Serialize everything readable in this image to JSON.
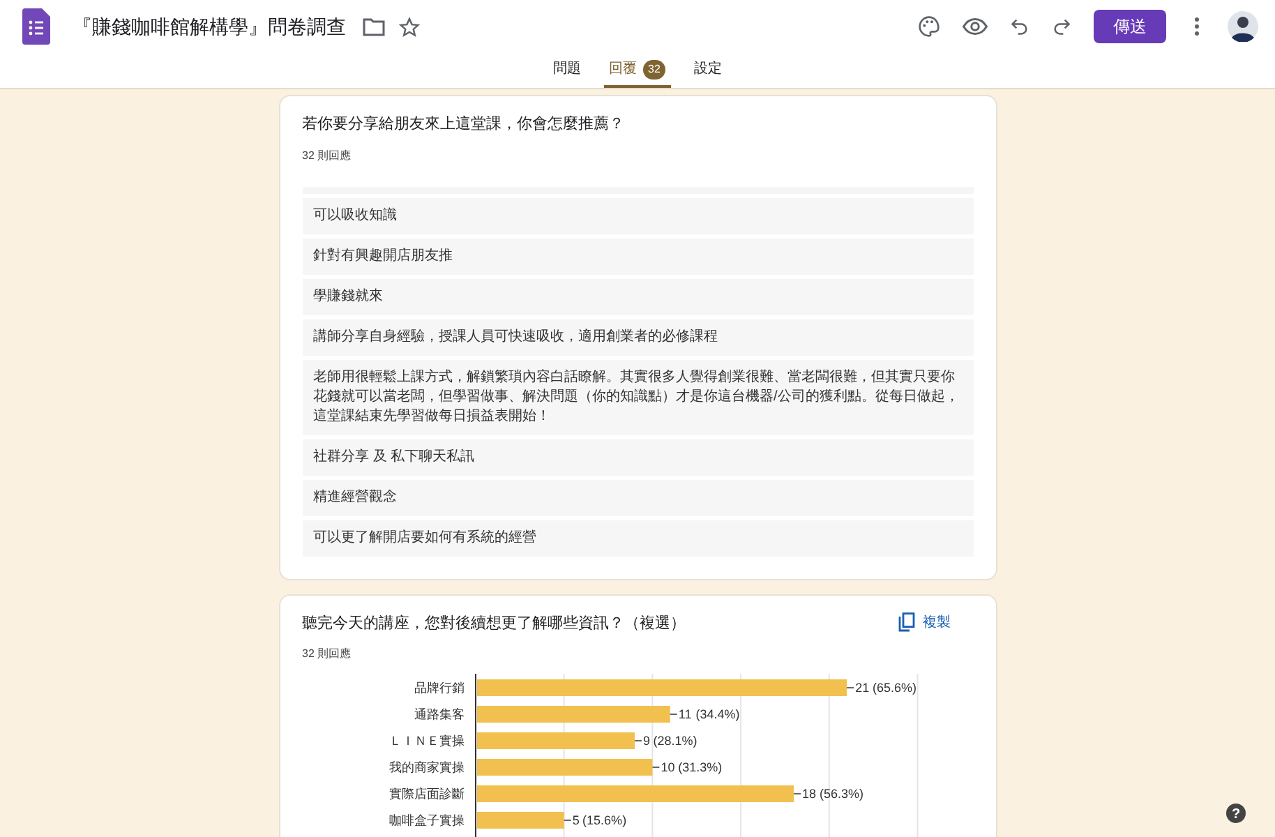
{
  "header": {
    "title": "『賺錢咖啡館解構學』問卷調查",
    "send_button": "傳送"
  },
  "tabs": [
    {
      "label": "問題",
      "selected": false
    },
    {
      "label": "回覆",
      "selected": true,
      "badge": "32"
    },
    {
      "label": "設定",
      "selected": false
    }
  ],
  "cards": [
    {
      "kind": "text",
      "question": "若你要分享給朋友來上這堂課，你會怎麼推薦？",
      "count": "32 則回應",
      "responses": [
        "可以吸收知識",
        "針對有興趣開店朋友推",
        "學賺錢就來",
        "講師分享自身經驗，授課人員可快速吸收，適用創業者的必修課程",
        "老師用很輕鬆上課方式，解鎖繁瑣內容白話瞭解。其實很多人覺得創業很難、當老闆很難，但其實只要你花錢就可以當老闆，但學習做事、解決問題（你的知識點）才是你這台機器/公司的獲利點。從每日做起，這堂課結束先學習做每日損益表開始！",
        "社群分享 及 私下聊天私訊",
        "精進經營觀念",
        "可以更了解開店要如何有系統的經營"
      ]
    },
    {
      "kind": "chart",
      "question": "聽完今天的講座，您對後續想更了解哪些資訊？（複選）",
      "count": "32 則回應",
      "copy_button": "複製",
      "chart_data": {
        "type": "bar",
        "orientation": "horizontal",
        "categories": [
          "品牌行銷",
          "通路集客",
          "ＬＩＮＥ實操",
          "我的商家實操",
          "實際店面診斷",
          "咖啡盒子實操"
        ],
        "series": [
          {
            "color": "#f1c04f",
            "values": [
              21,
              11,
              9,
              10,
              18,
              5
            ]
          }
        ],
        "data_labels": true,
        "annotations": [
          "(65.6%)",
          "(34.4%)",
          "(28.1%)",
          "(31.3%)",
          "(56.3%)",
          "(15.6%)"
        ]
      }
    }
  ],
  "help_button": "?"
}
